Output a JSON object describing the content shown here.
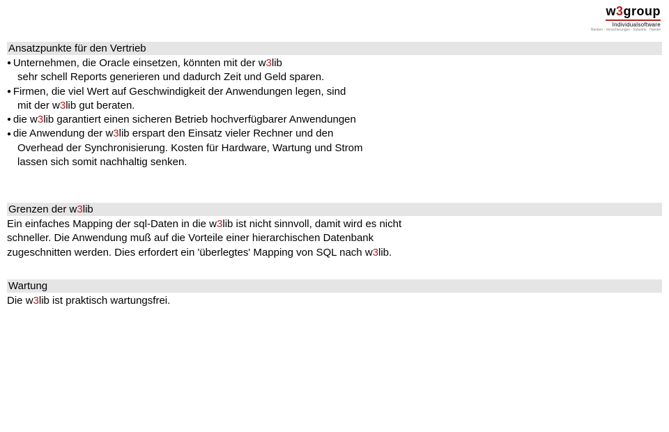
{
  "logo": {
    "main_w": "w",
    "main_3": "3",
    "main_group": "group",
    "sub": "Individualsoftware",
    "tiny": "Banken · Versicherungen · Industrie · Handel"
  },
  "brand": {
    "w": "w",
    "three": "3",
    "lib": "lib"
  },
  "section1": {
    "heading": "Ansatzpunkte für den Vertrieb",
    "b1_a": "Unternehmen, die Oracle einsetzen, könnten mit der ",
    "b1_b": "sehr schell Reports generieren und dadurch Zeit und Geld sparen.",
    "b2_a": "Firmen, die viel Wert auf Geschwindigkeit der Anwendungen legen, sind",
    "b2_b": "mit der ",
    "b2_c": " gut beraten.",
    "b3_a": "die ",
    "b3_b": " garantiert einen sicheren Betrieb hochverfügbarer Anwendungen",
    "b4_a": "die Anwendung der ",
    "b4_b": " erspart den Einsatz vieler Rechner und den",
    "b4_c": "Overhead der Synchronisierung. Kosten für Hardware, Wartung und Strom",
    "b4_d": "lassen sich somit nachhaltig senken."
  },
  "section2": {
    "heading_a": "Grenzen der ",
    "p1_a": "Ein einfaches Mapping der sql-Daten in die ",
    "p1_b": " ist nicht sinnvoll, damit wird es nicht",
    "p1_c": "schneller. Die Anwendung muß auf die Vorteile einer hierarchischen Datenbank",
    "p1_d": "zugeschnitten werden. Dies erfordert ein 'überlegtes' Mapping von SQL nach ",
    "p1_e": "."
  },
  "section3": {
    "heading": "Wartung",
    "p1_a": "Die ",
    "p1_b": " ist praktisch wartungsfrei."
  }
}
